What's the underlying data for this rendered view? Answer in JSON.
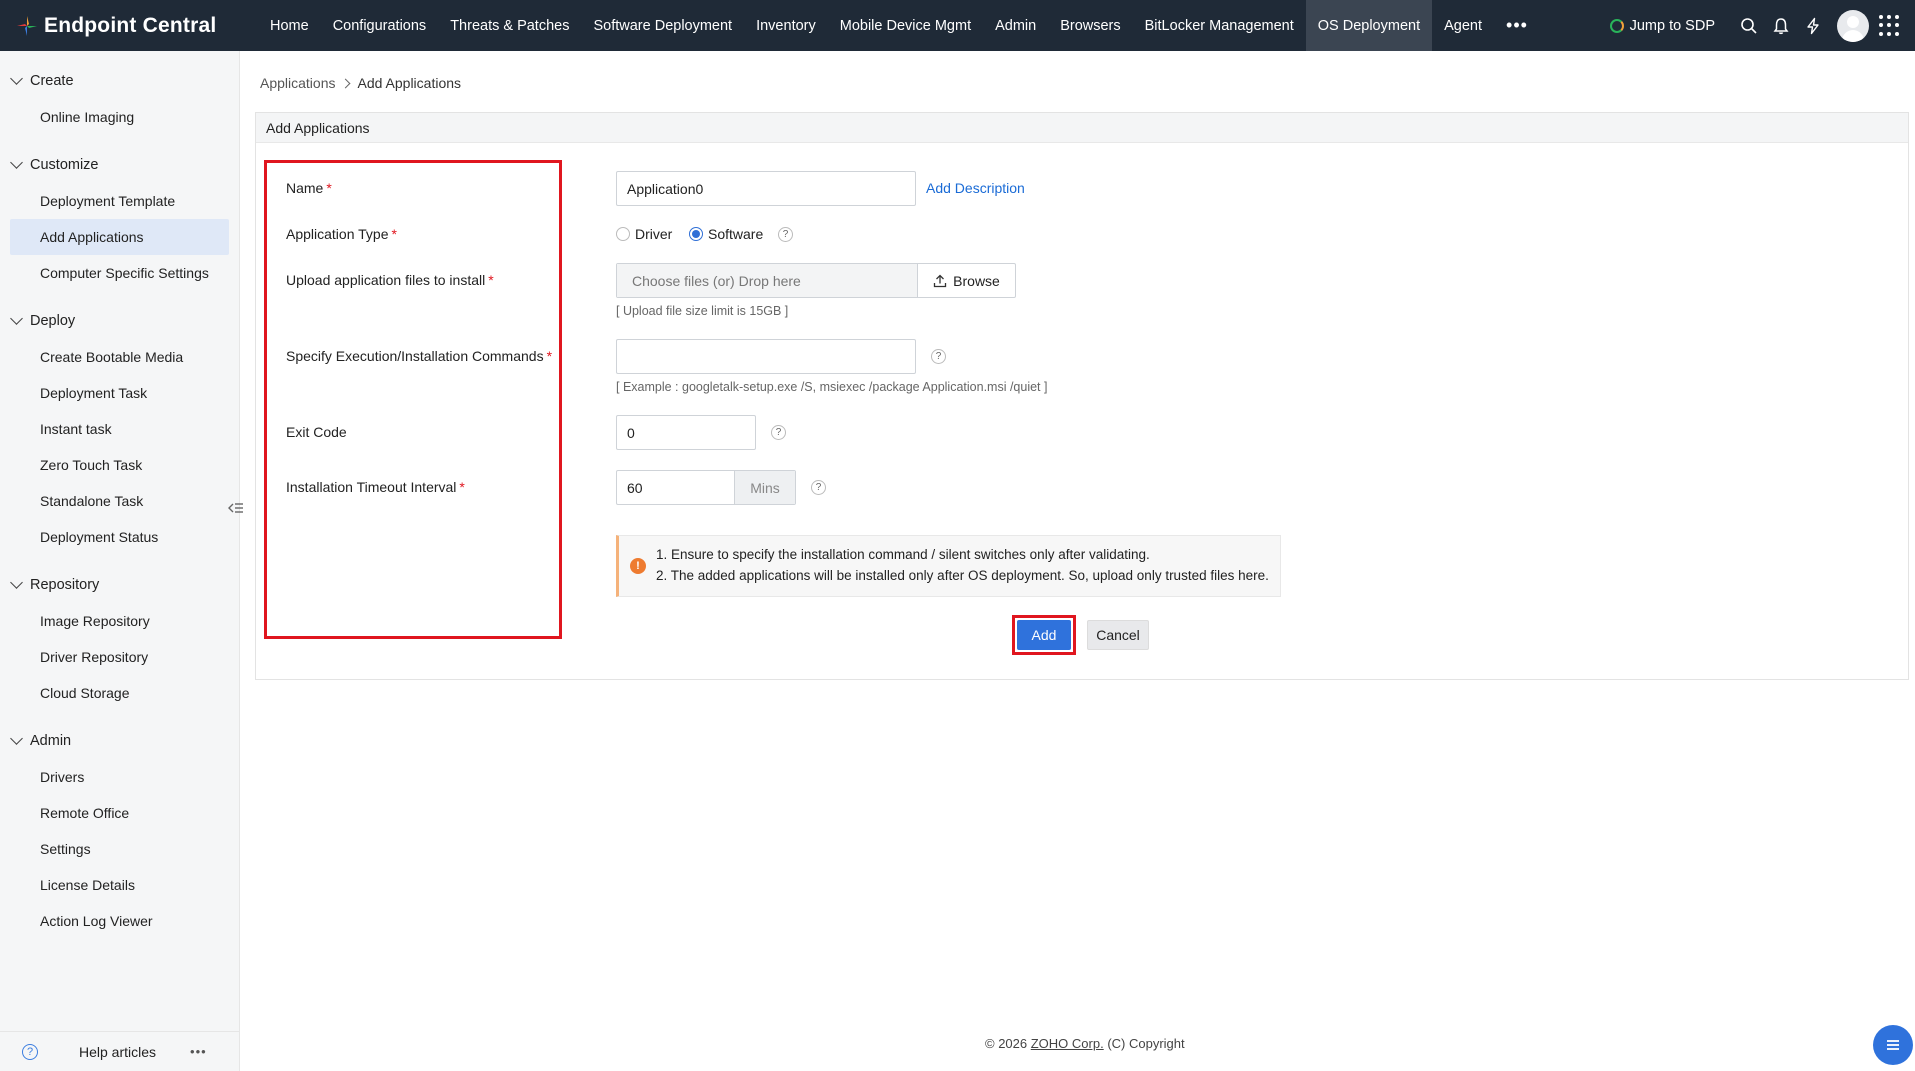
{
  "app": {
    "brand": "Endpoint Central",
    "nav": [
      {
        "label": "Home"
      },
      {
        "label": "Configurations"
      },
      {
        "label": "Threats & Patches"
      },
      {
        "label": "Software Deployment"
      },
      {
        "label": "Inventory"
      },
      {
        "label": "Mobile Device Mgmt"
      },
      {
        "label": "Admin"
      },
      {
        "label": "Browsers"
      },
      {
        "label": "BitLocker Management"
      },
      {
        "label": "OS Deployment",
        "active": true
      },
      {
        "label": "Agent"
      }
    ],
    "more_label": "•••",
    "jump_label": "Jump to SDP"
  },
  "sidebar": {
    "sections": [
      {
        "title": "Create",
        "items": [
          "Online Imaging"
        ]
      },
      {
        "title": "Customize",
        "items": [
          "Deployment Template",
          "Add Applications",
          "Computer Specific Settings"
        ]
      },
      {
        "title": "Deploy",
        "items": [
          "Create Bootable Media",
          "Deployment Task",
          "Instant task",
          "Zero Touch Task",
          "Standalone Task",
          "Deployment Status"
        ]
      },
      {
        "title": "Repository",
        "items": [
          "Image Repository",
          "Driver Repository",
          "Cloud Storage"
        ]
      },
      {
        "title": "Admin",
        "items": [
          "Drivers",
          "Remote Office",
          "Settings",
          "License Details",
          "Action Log Viewer"
        ]
      }
    ],
    "active_item": "Add Applications",
    "help_label": "Help articles",
    "help_more": "•••"
  },
  "breadcrumb": {
    "parent": "Applications",
    "current": "Add Applications"
  },
  "panel": {
    "title": "Add Applications"
  },
  "form": {
    "name_label": "Name",
    "name_value": "Application0",
    "add_description": "Add Description",
    "type_label": "Application Type",
    "type_options": [
      "Driver",
      "Software"
    ],
    "type_selected": "Software",
    "upload_label": "Upload application files to install",
    "upload_placeholder": "Choose files (or) Drop here",
    "browse_label": "Browse",
    "upload_hint": "[ Upload file size limit is 15GB ]",
    "command_label": "Specify Execution/Installation Commands",
    "command_value": "",
    "command_hint": "[ Example : googletalk-setup.exe /S, msiexec /package Application.msi /quiet ]",
    "exit_label": "Exit Code",
    "exit_value": "0",
    "timeout_label": "Installation Timeout Interval",
    "timeout_value": "60",
    "timeout_unit": "Mins",
    "required_mark": "*",
    "help_mark": "?"
  },
  "alert": {
    "icon": "!",
    "lines": [
      "1. Ensure to specify the installation command / silent switches only after validating.",
      "2. The added applications will be installed only after OS deployment. So, upload only trusted files here."
    ]
  },
  "actions": {
    "add": "Add",
    "cancel": "Cancel"
  },
  "footer": {
    "prefix": "© 2026 ",
    "company": "ZOHO Corp.",
    "suffix": " (C) Copyright"
  },
  "colors": {
    "topbar": "#1f2a37",
    "accent": "#2f72dc",
    "highlight": "#e0161f",
    "link": "#1a6bd6"
  }
}
